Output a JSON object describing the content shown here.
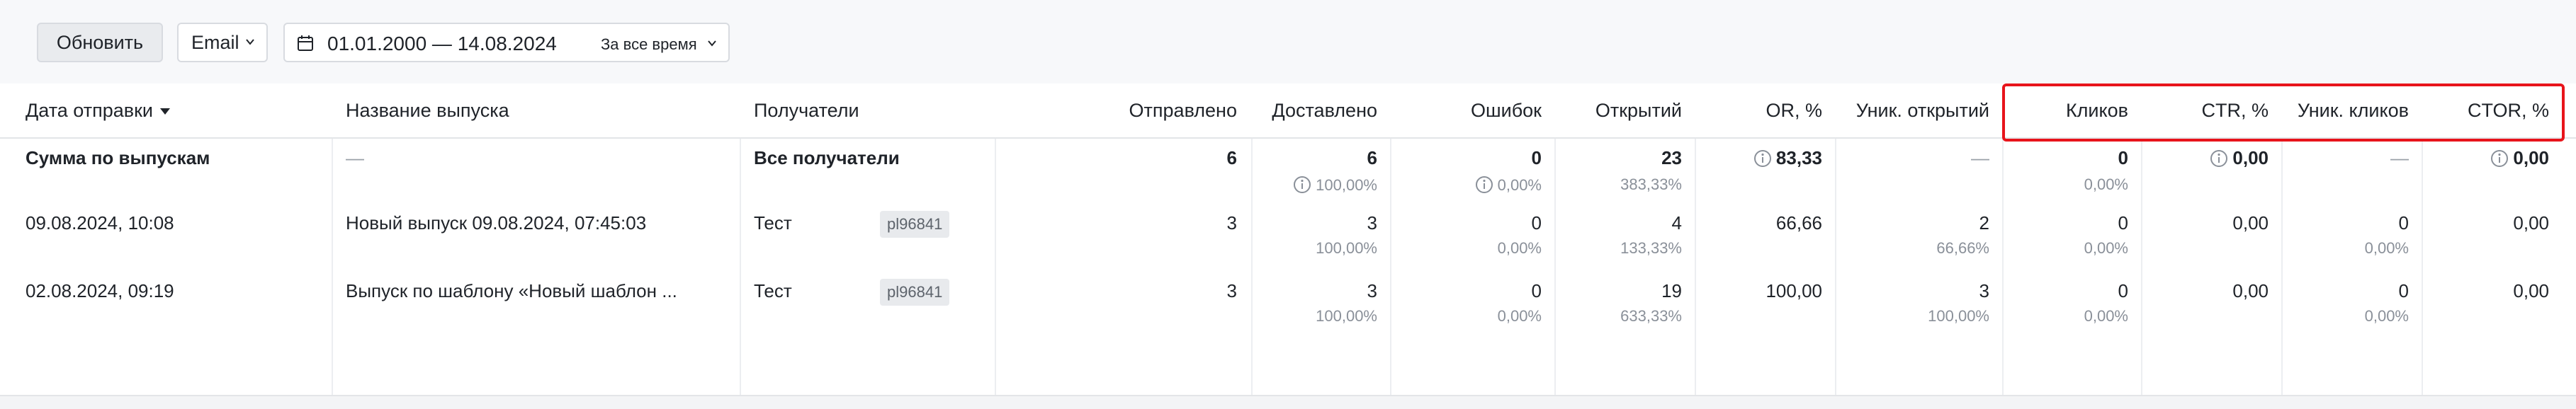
{
  "toolbar": {
    "refresh_label": "Обновить",
    "channel_value": "Email",
    "date_range": "01.01.2000 — 14.08.2024",
    "period_label": "За все время"
  },
  "table": {
    "headers": {
      "date": "Дата отправки",
      "name": "Название выпуска",
      "recipients": "Получатели",
      "sent": "Отправлено",
      "delivered": "Доставлено",
      "errors": "Ошибок",
      "opens": "Открытий",
      "or": "OR, %",
      "unique_opens": "Уник. открытий",
      "clicks": "Кликов",
      "ctr": "CTR, %",
      "unique_clicks": "Уник. кликов",
      "ctor": "CTOR, %"
    },
    "rows": [
      {
        "date": "Сумма по выпускам",
        "name": "—",
        "recipients": "Все получатели",
        "tag": "",
        "sent": "6",
        "delivered": "6",
        "delivered_pct": "100,00%",
        "errors": "0",
        "errors_pct": "0,00%",
        "opens": "23",
        "opens_pct": "383,33%",
        "or": "83,33",
        "unique_opens": "—",
        "unique_opens_pct": "",
        "clicks": "0",
        "clicks_pct": "0,00%",
        "ctr": "0,00",
        "unique_clicks": "—",
        "unique_clicks_pct": "",
        "ctor": "0,00"
      },
      {
        "date": "09.08.2024, 10:08",
        "name": "Новый выпуск 09.08.2024, 07:45:03",
        "recipients": "Тест",
        "tag": "pl96841",
        "sent": "3",
        "delivered": "3",
        "delivered_pct": "100,00%",
        "errors": "0",
        "errors_pct": "0,00%",
        "opens": "4",
        "opens_pct": "133,33%",
        "or": "66,66",
        "unique_opens": "2",
        "unique_opens_pct": "66,66%",
        "clicks": "0",
        "clicks_pct": "0,00%",
        "ctr": "0,00",
        "unique_clicks": "0",
        "unique_clicks_pct": "0,00%",
        "ctor": "0,00"
      },
      {
        "date": "02.08.2024, 09:19",
        "name": "Выпуск по шаблону «Новый шаблон ...",
        "recipients": "Тест",
        "tag": "pl96841",
        "sent": "3",
        "delivered": "3",
        "delivered_pct": "100,00%",
        "errors": "0",
        "errors_pct": "0,00%",
        "opens": "19",
        "opens_pct": "633,33%",
        "or": "100,00",
        "unique_opens": "3",
        "unique_opens_pct": "100,00%",
        "clicks": "0",
        "clicks_pct": "0,00%",
        "ctr": "0,00",
        "unique_clicks": "0",
        "unique_clicks_pct": "0,00%",
        "ctor": "0,00"
      }
    ]
  },
  "colors": {
    "highlight": "#e8141b",
    "toolbar_bg": "#f7f8fa"
  }
}
